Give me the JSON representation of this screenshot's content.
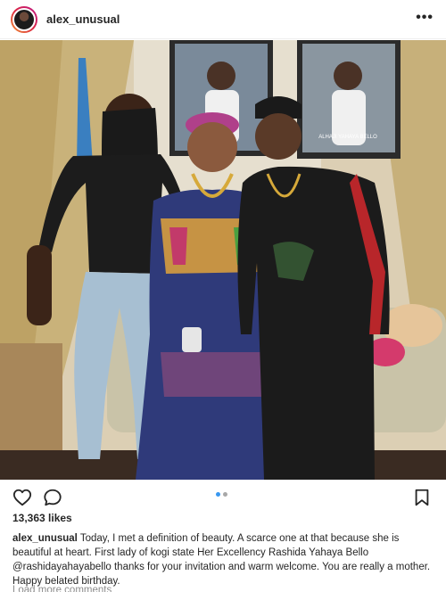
{
  "post": {
    "username": "alex_unusual",
    "more_glyph": "•••",
    "photo": {
      "description_alt": "",
      "poster_text": "ALHAJI YAHAYA BELLO"
    },
    "likes": "13,363 likes",
    "caption": {
      "username": "alex_unusual",
      "text_1": " Today, I met a definition of beauty. A scarce one at that because she is beautiful at heart. First lady of kogi state Her Excellency Rashida Yahaya Bello ",
      "mention": "@rashidayahayabello",
      "text_2": " thanks for your invitation and warm welcome. You are really a mother. Happy belated birthday."
    },
    "comments_link": "Load more comments",
    "carousel": {
      "count": 2,
      "active": 0
    }
  },
  "icons": {
    "avatar": "avatar",
    "more": "more-options-icon",
    "like": "heart-icon",
    "comment": "comment-icon",
    "save": "bookmark-icon"
  },
  "colors": {
    "accent": "#3897f0",
    "text": "#262626",
    "muted": "#8e8e8e"
  }
}
